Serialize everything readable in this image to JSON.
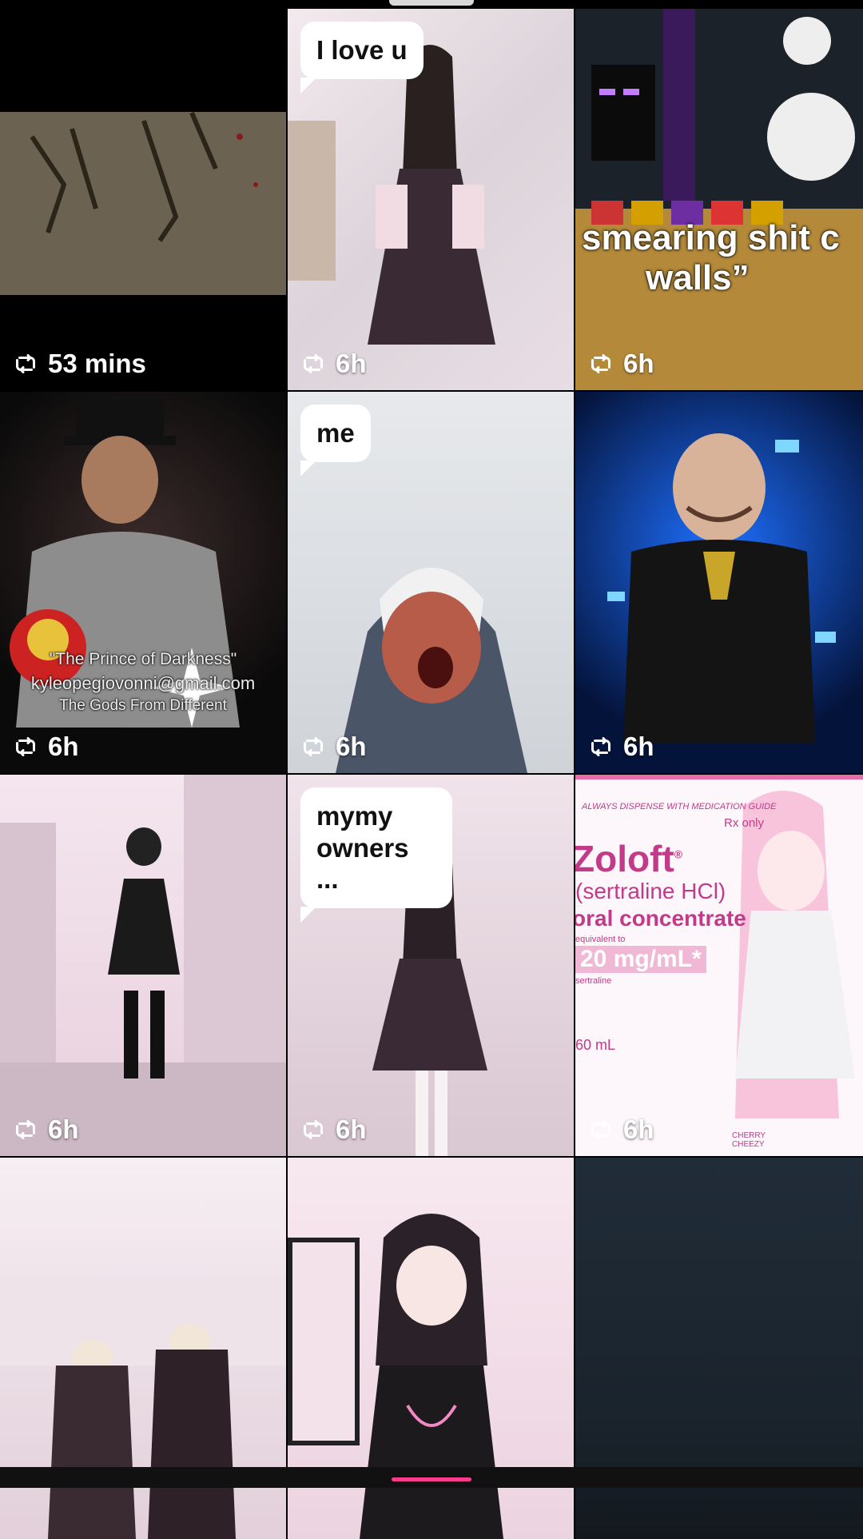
{
  "grid": {
    "items": [
      {
        "reposted": true,
        "time": "53 mins",
        "bubble": "",
        "caption": ""
      },
      {
        "reposted": true,
        "time": "6h",
        "bubble": "I love u",
        "caption": ""
      },
      {
        "reposted": true,
        "time": "6h",
        "bubble": "",
        "caption": "smearing shit c walls”"
      },
      {
        "reposted": true,
        "time": "6h",
        "bubble": "",
        "caption": "\"The Prince of Darkness\"",
        "caption2": "kyleopegiovonni@gmail.com",
        "caption3": "The Gods From Different"
      },
      {
        "reposted": true,
        "time": "6h",
        "bubble": "me",
        "caption": ""
      },
      {
        "reposted": true,
        "time": "6h",
        "bubble": "",
        "caption": ""
      },
      {
        "reposted": true,
        "time": "6h",
        "bubble": "",
        "caption": ""
      },
      {
        "reposted": true,
        "time": "6h",
        "bubble": "mymy owners ...",
        "caption": ""
      },
      {
        "reposted": true,
        "time": "6h",
        "bubble": "",
        "caption": "",
        "label": {
          "top": "ALWAYS DISPENSE WITH MEDICATION GUIDE",
          "rx": "Rx only",
          "brand": "Zoloft",
          "generic": "(sertraline HCl)",
          "form": "oral concentrate",
          "equiv": "equivalent to",
          "dose": "20 mg/mL",
          "sub": "sertraline",
          "vol": "60 mL",
          "artist": "CHERRY CHEEZY"
        }
      },
      {
        "reposted": false,
        "time": "",
        "bubble": "",
        "caption": ""
      },
      {
        "reposted": false,
        "time": "",
        "bubble": "",
        "caption": ""
      },
      {
        "reposted": false,
        "time": "",
        "bubble": "",
        "caption": ""
      }
    ]
  },
  "icons": {
    "repost": "repost-icon"
  },
  "colors": {
    "background": "#000000",
    "overlay_text": "#ffffff",
    "accent": "#ff3b8d"
  }
}
